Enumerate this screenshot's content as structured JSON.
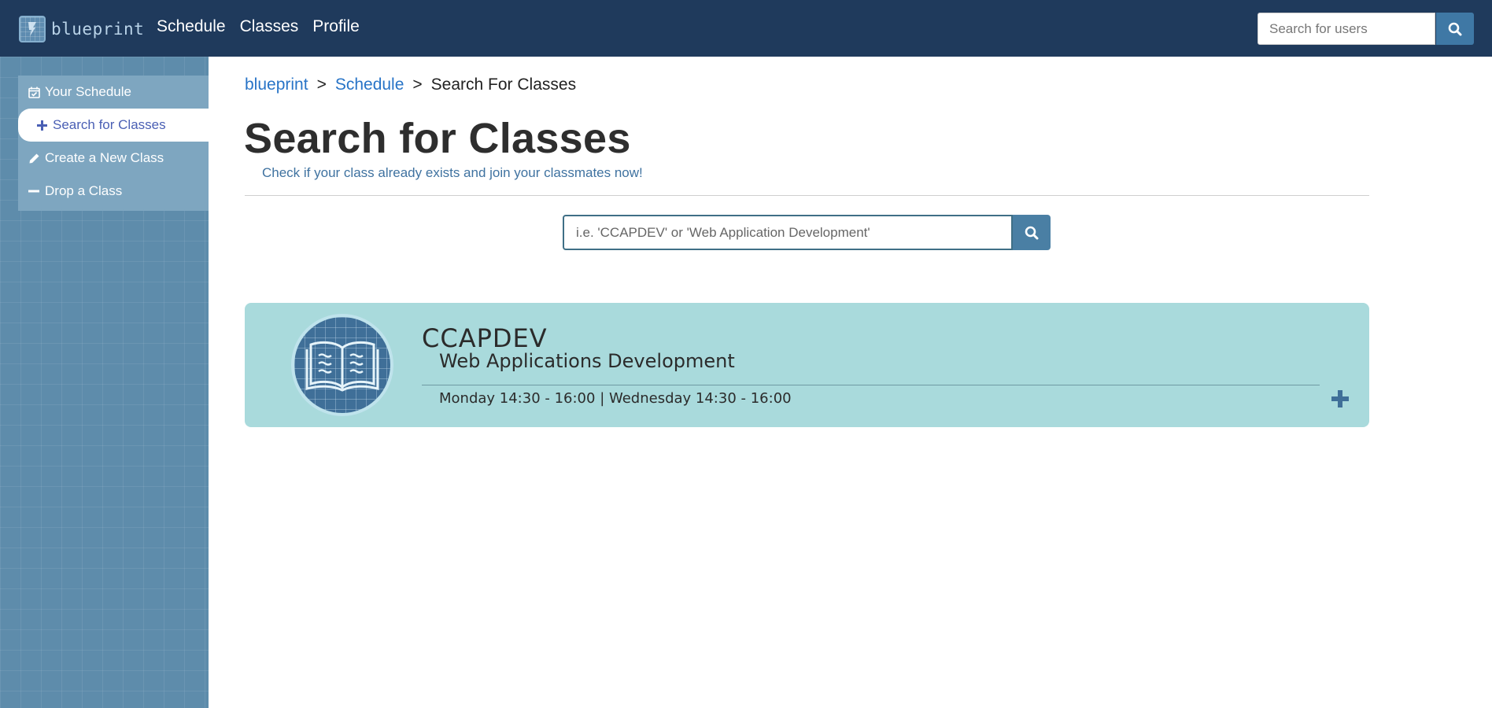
{
  "navbar": {
    "brand": "blueprint",
    "links": [
      "Schedule",
      "Classes",
      "Profile"
    ],
    "user_search_placeholder": "Search for users",
    "search_icon": "search-icon"
  },
  "sidebar": {
    "items": [
      {
        "label": "Your Schedule",
        "icon": "calendar-check-icon"
      },
      {
        "label": "Search for Classes",
        "icon": "plus-icon"
      },
      {
        "label": "Create a New Class",
        "icon": "pencil-icon"
      },
      {
        "label": "Drop a Class",
        "icon": "minus-icon"
      }
    ]
  },
  "breadcrumb": {
    "items": [
      "blueprint",
      "Schedule",
      "Search For Classes"
    ],
    "separator": ">"
  },
  "main": {
    "title": "Search for Classes",
    "subtitle": "Check if your class already exists and join your classmates now!",
    "search_placeholder": "i.e. 'CCAPDEV' or 'Web Application Development'"
  },
  "results": [
    {
      "code": "CCAPDEV",
      "name": "Web Applications Development",
      "schedule": "Monday 14:30 - 16:00 | Wednesday 14:30 - 16:00",
      "icon": "open-book-icon",
      "action_icon": "plus-icon"
    }
  ],
  "colors": {
    "navbar": "#1f3a5c",
    "sidebar": "#5e8cab",
    "accent": "#3f78a5",
    "card": "#a9dadc",
    "link": "#2874c7"
  }
}
